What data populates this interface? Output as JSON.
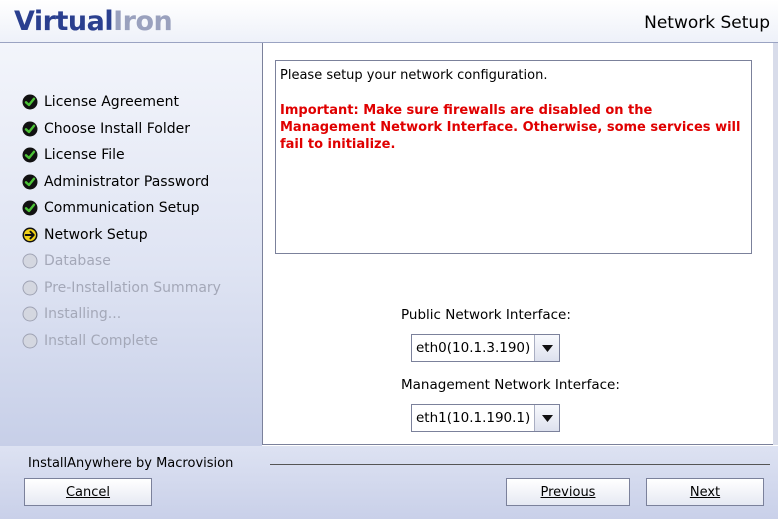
{
  "header": {
    "logo": {
      "part1": "Virtual",
      "part2": "Iron"
    },
    "title": "Network Setup"
  },
  "steps": [
    {
      "label": "License Agreement",
      "status": "done"
    },
    {
      "label": "Choose Install Folder",
      "status": "done"
    },
    {
      "label": "License File",
      "status": "done"
    },
    {
      "label": "Administrator Password",
      "status": "done"
    },
    {
      "label": "Communication Setup",
      "status": "done"
    },
    {
      "label": "Network Setup",
      "status": "current"
    },
    {
      "label": "Database",
      "status": "pending"
    },
    {
      "label": "Pre-Installation Summary",
      "status": "pending"
    },
    {
      "label": "Installing...",
      "status": "pending"
    },
    {
      "label": "Install Complete",
      "status": "pending"
    }
  ],
  "message": {
    "intro": "Please setup your network configuration.",
    "warning": "Important: Make sure firewalls are disabled on the Management Network Interface. Otherwise, some services will fail to initialize."
  },
  "fields": {
    "public": {
      "label": "Public Network Interface:",
      "value": "eth0(10.1.3.190)"
    },
    "management": {
      "label": "Management Network Interface:",
      "value": "eth1(10.1.190.1)"
    }
  },
  "footer": {
    "brand": "InstallAnywhere by Macrovision",
    "cancel": "Cancel",
    "previous": "Previous",
    "next": "Next"
  },
  "colors": {
    "done_check": "#2e8b22",
    "current_arrow": "#f2d21a",
    "warning_text": "#e00000",
    "logo_primary": "#2a3f8f"
  }
}
